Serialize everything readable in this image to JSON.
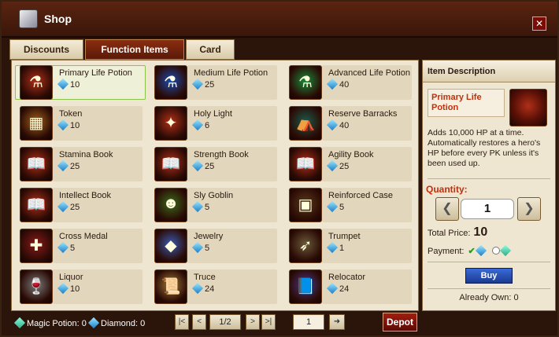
{
  "window": {
    "title": "Shop",
    "close_label": "✕"
  },
  "tabs": [
    {
      "label": "Discounts",
      "active": false
    },
    {
      "label": "Function Items",
      "active": true
    },
    {
      "label": "Card",
      "active": false
    }
  ],
  "items": [
    {
      "name": "Primary Life Potion",
      "price": "10",
      "icon": "red-potion-icon",
      "selected": true
    },
    {
      "name": "Medium Life Potion",
      "price": "25",
      "icon": "blue-potion-icon"
    },
    {
      "name": "Advanced Life Potion",
      "price": "40",
      "icon": "green-potion-icon"
    },
    {
      "name": "Token",
      "price": "10",
      "icon": "token-icon"
    },
    {
      "name": "Holy Light",
      "price": "6",
      "icon": "holy-light-icon"
    },
    {
      "name": "Reserve Barracks",
      "price": "40",
      "icon": "barracks-icon"
    },
    {
      "name": "Stamina Book",
      "price": "25",
      "icon": "stamina-book-icon"
    },
    {
      "name": "Strength Book",
      "price": "25",
      "icon": "strength-book-icon"
    },
    {
      "name": "Agility Book",
      "price": "25",
      "icon": "agility-book-icon"
    },
    {
      "name": "Intellect Book",
      "price": "25",
      "icon": "intellect-book-icon"
    },
    {
      "name": "Sly Goblin",
      "price": "5",
      "icon": "goblin-icon"
    },
    {
      "name": "Reinforced Case",
      "price": "5",
      "icon": "case-icon"
    },
    {
      "name": "Cross Medal",
      "price": "5",
      "icon": "cross-medal-icon"
    },
    {
      "name": "Jewelry",
      "price": "5",
      "icon": "jewelry-icon"
    },
    {
      "name": "Trumpet",
      "price": "1",
      "icon": "trumpet-icon"
    },
    {
      "name": "Liquor",
      "price": "10",
      "icon": "liquor-icon"
    },
    {
      "name": "Truce",
      "price": "24",
      "icon": "truce-scroll-icon"
    },
    {
      "name": "Relocator",
      "price": "24",
      "icon": "relocator-icon"
    }
  ],
  "footer": {
    "magic_potion": "Magic Potion: 0",
    "diamond": "Diamond: 0",
    "page": "1/2",
    "goto_page": "1",
    "depot_label": "Depot"
  },
  "description": {
    "heading": "Item Description",
    "item_name": "Primary Life Potion",
    "text": "Adds 10,000 HP at a time. Automatically restores a hero's HP before every PK unless it's been used up.",
    "quantity_label": "Quantity:",
    "quantity": "1",
    "total_label": "Total Price:",
    "total_value": "10",
    "payment_label": "Payment:",
    "buy_label": "Buy",
    "already_own": "Already Own: 0"
  }
}
